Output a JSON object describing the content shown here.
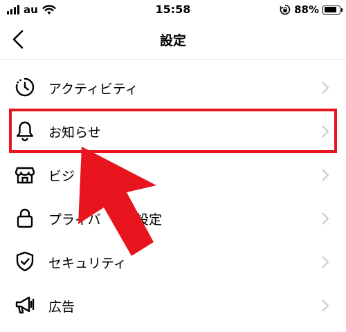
{
  "status_bar": {
    "carrier": "au",
    "time": "15:58",
    "battery_percent_text": "88%",
    "battery_level": 0.88
  },
  "nav": {
    "title": "設定"
  },
  "menu": {
    "items": [
      {
        "label": "アクティビティ",
        "icon": "activity-timer-icon"
      },
      {
        "label": "お知らせ",
        "icon": "bell-icon"
      },
      {
        "label": "ビジ",
        "icon": "storefront-icon"
      },
      {
        "label": "プライバ",
        "label_tail": "設定",
        "icon": "padlock-icon"
      },
      {
        "label": "セキュリティ",
        "icon": "shield-check-icon"
      },
      {
        "label": "広告",
        "icon": "megaphone-icon"
      }
    ]
  },
  "colors": {
    "highlight": "#e8141e",
    "divider": "#e0e0e0",
    "chevron": "#c7c7cc"
  }
}
